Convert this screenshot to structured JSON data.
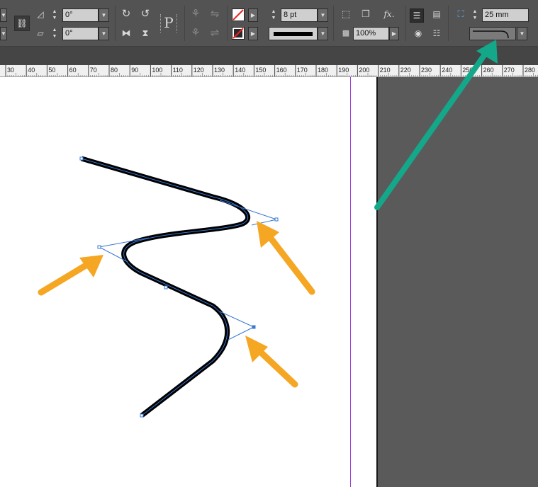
{
  "control_panel": {
    "rotate_angle": "0°",
    "shear_angle": "0°",
    "stroke_weight": "8 pt",
    "opacity": "100%",
    "corner_size": "25 mm",
    "text_path_glyph": "P",
    "effects_glyph": "fx."
  },
  "ruler": {
    "ticks": [
      "30",
      "40",
      "50",
      "60",
      "70",
      "80",
      "90",
      "100",
      "110",
      "120",
      "130",
      "140",
      "150",
      "160",
      "170",
      "180",
      "190",
      "200",
      "210",
      "220",
      "230",
      "240",
      "250",
      "260",
      "270",
      "280"
    ]
  },
  "annotations": {
    "arrow_orange_color": "#f5a623",
    "arrow_green_color": "#14a88a"
  },
  "colors": {
    "panel": "#535353",
    "path_selection": "#3a78d4",
    "margin_guide": "#9b3fd6"
  }
}
